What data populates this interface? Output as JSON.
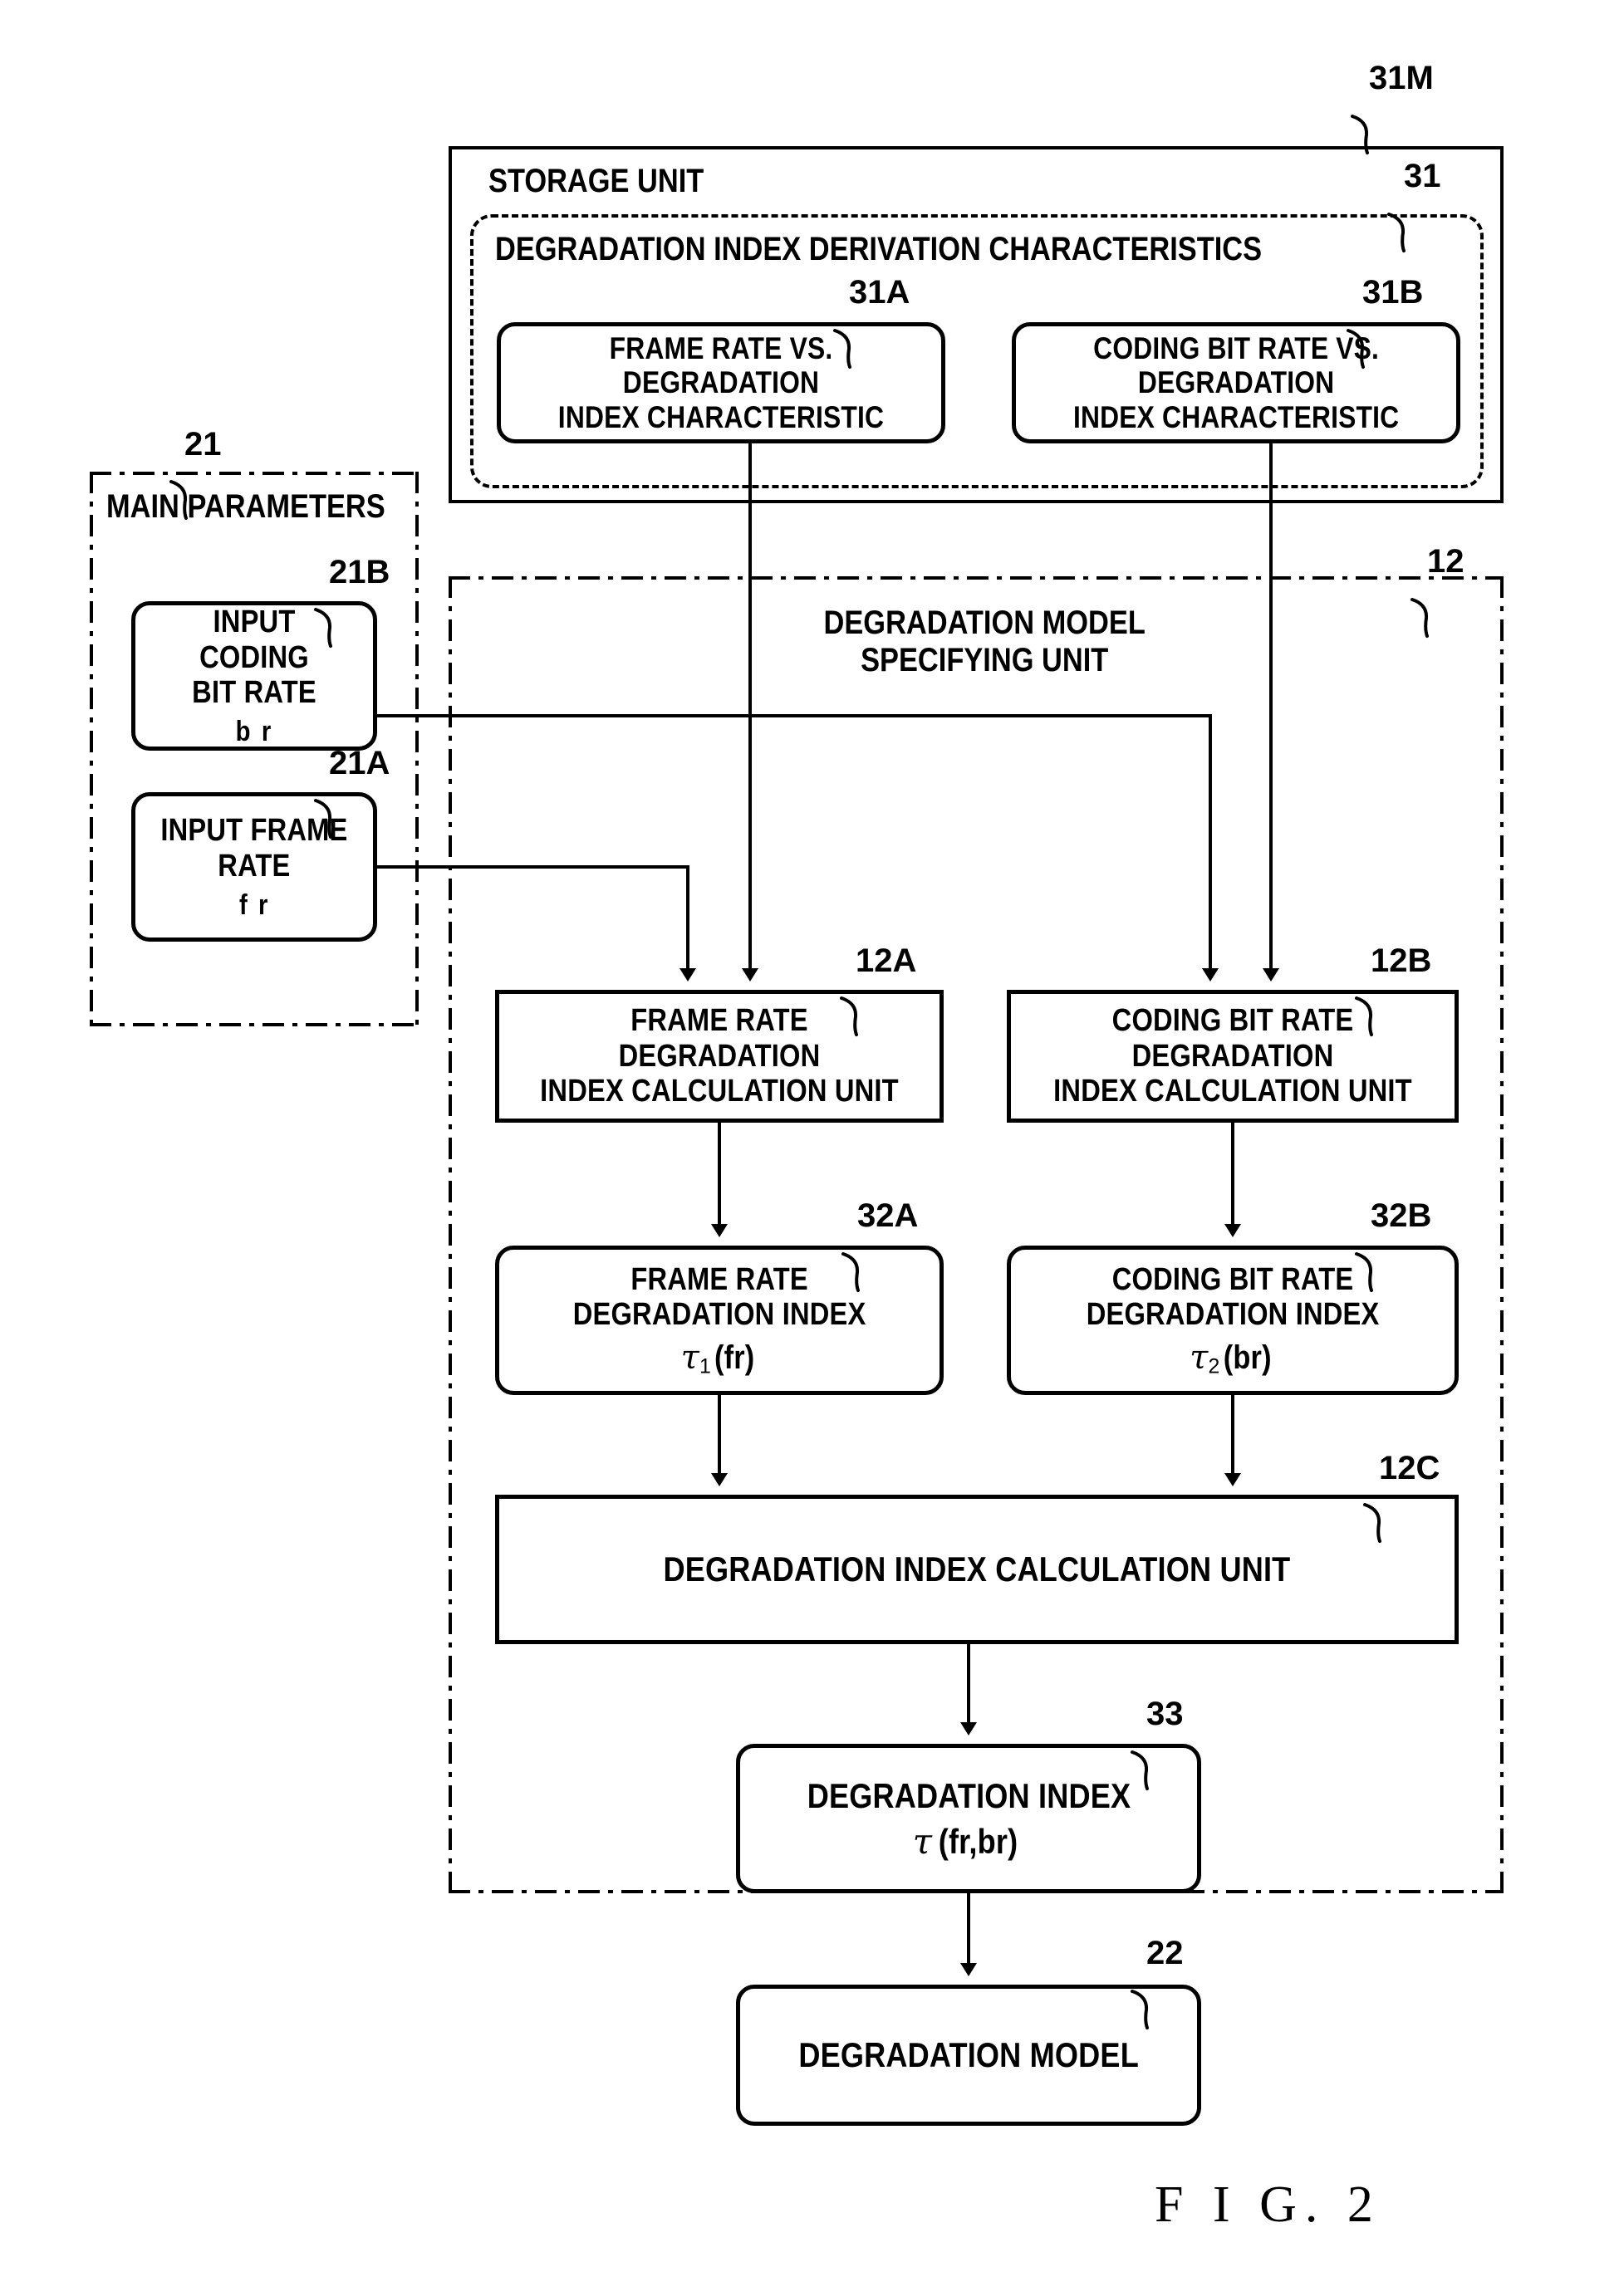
{
  "figure": {
    "caption": "F I G. 2"
  },
  "storage_unit": {
    "ref": "31M",
    "title": "STORAGE UNIT",
    "characteristics_group": {
      "ref": "31",
      "title": "DEGRADATION INDEX DERIVATION CHARACTERISTICS",
      "boxes": [
        {
          "ref": "31A",
          "label": "FRAME RATE VS. DEGRADATION\nINDEX CHARACTERISTIC"
        },
        {
          "ref": "31B",
          "label": "CODING BIT RATE VS.\nDEGRADATION\nINDEX CHARACTERISTIC"
        }
      ]
    }
  },
  "main_parameters": {
    "ref": "21",
    "title": "MAIN PARAMETERS",
    "boxes": [
      {
        "ref": "21B",
        "label": "INPUT CODING\nBIT RATE",
        "symbol": "b r"
      },
      {
        "ref": "21A",
        "label": "INPUT FRAME\nRATE",
        "symbol": "f r"
      }
    ]
  },
  "degradation_model_specifying_unit": {
    "ref": "12",
    "title": "DEGRADATION MODEL\nSPECIFYING UNIT",
    "calc_units": [
      {
        "ref": "12A",
        "label": "FRAME RATE DEGRADATION\nINDEX CALCULATION UNIT"
      },
      {
        "ref": "12B",
        "label": "CODING BIT RATE DEGRADATION\nINDEX CALCULATION UNIT"
      }
    ],
    "indices": [
      {
        "ref": "32A",
        "label": "FRAME RATE\nDEGRADATION INDEX",
        "symbol_tau": "τ",
        "symbol_sub": "1",
        "symbol_arg": "(fr)"
      },
      {
        "ref": "32B",
        "label": "CODING BIT RATE\nDEGRADATION INDEX",
        "symbol_tau": "τ",
        "symbol_sub": "2",
        "symbol_arg": "(br)"
      }
    ],
    "index_calc_unit": {
      "ref": "12C",
      "label": "DEGRADATION INDEX CALCULATION UNIT"
    },
    "degradation_index": {
      "ref": "33",
      "label": "DEGRADATION INDEX",
      "symbol_tau": "τ",
      "symbol_arg": "(fr,br)"
    }
  },
  "degradation_model": {
    "ref": "22",
    "label": "DEGRADATION MODEL"
  }
}
